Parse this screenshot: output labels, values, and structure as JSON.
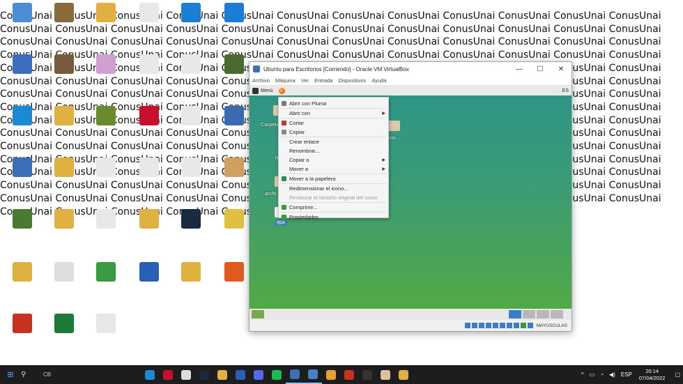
{
  "wallpaper": {
    "word": "ConusUnai",
    "text": "ConusUnai ConusUnai ConusUnai ConusUnai ConusUnai ConusUnai ConusUnai ConusUnai ConusUnai ConusUnai ConusUnai ConusUnai ConusUnai ConusUnai ConusUnai ConusUnai ConusUnai ConusUnai ConusUnai ConusUnai ConusUnai ConusUnai ConusUnai ConusUnai ConusUnai ConusUnai ConusUnai ConusUnai ConusUnai ConusUnai ConusUnai ConusUnai ConusUnai ConusUnai ConusUnai ConusUnai ConusUnai ConusUnai ConusUnai ConusUnai ConusUnai ConusUnai ConusUnai ConusUnai ConusUnai ConusUnai ConusUnai ConusUnai ConusUnai ConusUnai ConusUnai ConusUnai ConusUnai ConusUnai ConusUnai ConusUnai ConusUnai ConusUnai ConusUnai ConusUnai ConusUnai ConusUnai ConusUnai ConusUnai ConusUnai ConusUnai ConusUnai ConusUnai ConusUnai ConusUnai ConusUnai ConusUnai ConusUnai ConusUnai ConusUnai ConusUnai ConusUnai ConusUnai ConusUnai ConusUnai ConusUnai ConusUnai ConusUnai ConusUnai ConusUnai ConusUnai ConusUnai ConusUnai ConusUnai ConusUnai ConusUnai ConusUnai ConusUnai ConusUnai ConusUnai ConusUnai ConusUnai ConusUnai ConusUnai ConusUnai ConusUnai ConusUnai ConusUnai ConusUnai ConusUnai ConusUnai ConusUnai ConusUnai ConusUnai ConusUnai ConusUnai ConusUnai ConusUnai ConusUnai ConusUnai ConusUnai ConusUnai ConusUnai ConusUnai ConusUnai ConusUnai ConusUnai ConusUnai ConusUnai ConusUnai ConusUnai ConusUnai ConusUnai ConusUnai ConusUnai ConusUnai ConusUnai ConusUnai ConusUnai ConusUnai ConusUnai ConusUnai ConusUnai ConusUnai ConusUnai ConusUnai ConusUnai ConusUnai ConusUnai ConusUnai ConusUnai ConusUnai ConusUnai ConusUnai ConusUnai ConusUnai ConusUnai ConusUnai ConusUnai ConusUnai ConusUnai ConusUnai ConusUnai ConusUnai ConusUnai ConusUnai ConusUnai ConusUnai ConusUnai ConusUnai ConusUnai ConusUnai ConusUnai ConusUnai ConusUnai ConusUnai ConusUnai ConusUnai ConusUnai ConusUnai ConusUnai ConusUnai ConusUnai ConusUnai ConusUnai ConusUnai ConusUnai ConusUnai ConusUnai ConusUnai Conus"
  },
  "desktop_colors": [
    "#4a8fd4",
    "#8a6a3a",
    "#e0b040",
    "#e8e8e8",
    "#1a7fd4",
    "#1a7fd4",
    "#3a6fc0",
    "#7a5a3a",
    "#cfa0d0",
    "#e8e8e8",
    "#e8e8e8",
    "#4a6a30",
    "#1a8ad4",
    "#e0b040",
    "#6a8a30",
    "#c8102e",
    "#e8e8e8",
    "#3a6ab0",
    "#3b6fb6",
    "#e0b040",
    "#e8e8e8",
    "#e8e8e8",
    "#e8e8e8",
    "#d0a060",
    "#4a7a30",
    "#e0b040",
    "#e8e8e8",
    "#e0b040",
    "#1a2a40",
    "#e0c040",
    "#e0b040",
    "#dddddd",
    "#3a9a40",
    "#2b5fb5",
    "#e0b040",
    "#e05a20",
    "#c83020",
    "#1f7a3a",
    "#e8e8e8"
  ],
  "vbox": {
    "title": "Ubuntu para Escritorios [Corriendo] - Oracle VM VirtualBox",
    "menu": [
      "Archivo",
      "Máquina",
      "Ver",
      "Entrada",
      "Dispositivos",
      "Ayuda"
    ],
    "min_glyph": "—",
    "max_glyph": "☐",
    "close_glyph": "✕",
    "status_text": "MAYÚSCULAS"
  },
  "guest": {
    "panel_menu": "Menú",
    "keyboard": "ES",
    "icons": [
      "Carpeta de",
      "archi",
      "dios",
      "hc"
    ],
    "selected_icon": "epa"
  },
  "context_menu": [
    {
      "label": "Abrir con Pluma",
      "icon_color": "#7a7a7a",
      "submenu": false,
      "disabled": false,
      "sep_after": true
    },
    {
      "label": "Abrir con",
      "icon_color": "",
      "submenu": true,
      "disabled": false,
      "sep_after": true
    },
    {
      "label": "Cortar",
      "icon_color": "#c0392b",
      "submenu": false,
      "disabled": false,
      "sep_after": false
    },
    {
      "label": "Copiar",
      "icon_color": "#888888",
      "submenu": false,
      "disabled": false,
      "sep_after": true
    },
    {
      "label": "Crear enlace",
      "icon_color": "",
      "submenu": false,
      "disabled": false,
      "sep_after": false
    },
    {
      "label": "Renombrar...",
      "icon_color": "",
      "submenu": false,
      "disabled": false,
      "sep_after": false
    },
    {
      "label": "Copiar a",
      "icon_color": "",
      "submenu": true,
      "disabled": false,
      "sep_after": false
    },
    {
      "label": "Mover a",
      "icon_color": "",
      "submenu": true,
      "disabled": false,
      "sep_after": true
    },
    {
      "label": "Mover a la papelera",
      "icon_color": "#2e8b57",
      "submenu": false,
      "disabled": false,
      "sep_after": true
    },
    {
      "label": "Redimensionar el icono...",
      "icon_color": "",
      "submenu": false,
      "disabled": false,
      "sep_after": false
    },
    {
      "label": "Restaurar el tamaño original del icono",
      "icon_color": "",
      "submenu": false,
      "disabled": true,
      "sep_after": true
    },
    {
      "label": "Comprimir...",
      "icon_color": "#3a9a3a",
      "submenu": false,
      "disabled": false,
      "sep_after": true
    },
    {
      "label": "Propiedades",
      "icon_color": "#3a9a3a",
      "submenu": false,
      "disabled": false,
      "sep_after": false
    }
  ],
  "taskbar": {
    "search_text": "CB",
    "apps": [
      {
        "name": "edge-icon",
        "color": "#1a8ad4"
      },
      {
        "name": "opera-icon",
        "color": "#c8102e"
      },
      {
        "name": "unity-icon",
        "color": "#dddddd"
      },
      {
        "name": "steam-icon",
        "color": "#1b2838"
      },
      {
        "name": "file-explorer-icon",
        "color": "#e0b040"
      },
      {
        "name": "word-icon",
        "color": "#2b5fb5"
      },
      {
        "name": "discord-icon",
        "color": "#5865f2"
      },
      {
        "name": "spotify-icon",
        "color": "#1db954"
      },
      {
        "name": "virtualbox-icon",
        "color": "#3b6fb6"
      },
      {
        "name": "virtualbox-manager-icon",
        "color": "#4a7fc6"
      },
      {
        "name": "chrome-icon",
        "color": "#e8a030"
      },
      {
        "name": "game-icon",
        "color": "#c83020"
      },
      {
        "name": "epic-games-icon",
        "color": "#333333"
      },
      {
        "name": "anime-app-icon",
        "color": "#e0c0a0"
      },
      {
        "name": "tools-icon",
        "color": "#e0b040"
      }
    ],
    "tray": {
      "chevron": "^",
      "lang": "ESP",
      "time": "20:14",
      "date": "07/04/2022"
    }
  }
}
